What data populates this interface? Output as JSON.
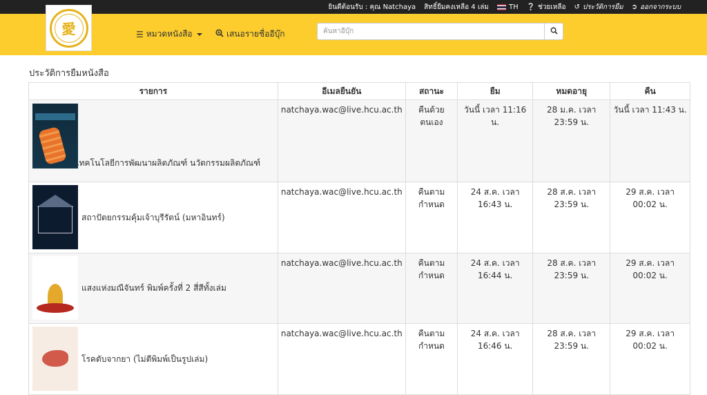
{
  "topbar": {
    "welcome": "ยินดีต้อนรับ : คุณ Natchaya",
    "quota": "สิทธิ์ยืมคงเหลือ 4 เล่ม",
    "lang": "TH",
    "help": "ช่วยเหลือ",
    "history": "ประวัติการยืม",
    "logout": "ออกจากระบบ"
  },
  "header": {
    "categories": "หมวดหนังสือ",
    "suggest": "เสนอรายชื่ออีบุ๊ก",
    "search_placeholder": "ค้นหาอีบุ๊ก"
  },
  "page_title": "ประวัติการยืมหนังสือ",
  "table": {
    "headers": [
      "รายการ",
      "อีเมลยืนยัน",
      "สถานะ",
      "ยืม",
      "หมดอายุ",
      "คืน"
    ],
    "rows": [
      {
        "title": "หลักการทางเทคโนโลยีการพัฒนาผลิตภัณฑ์ นวัตกรรมผลิตภัณฑ์",
        "email": "natchaya.wac@live.hcu.ac.th",
        "status": "คืนด้วยตนเอง",
        "borrow": "วันนี้ เวลา 11:16 น.",
        "expire": "28 ม.ค. เวลา 23:59 น.",
        "return": "วันนี้ เวลา 11:43 น."
      },
      {
        "title": "สถาปัตยกรรมคุ้มเจ้าบุรีรัตน์ (มหาอินทร์)",
        "email": "natchaya.wac@live.hcu.ac.th",
        "status": "คืนตามกำหนด",
        "borrow": "24 ส.ค. เวลา 16:43 น.",
        "expire": "28 ส.ค. เวลา 23:59 น.",
        "return": "29 ส.ค. เวลา 00:02 น."
      },
      {
        "title": "แสงแห่งมณีจันทร์ พิมพ์ครั้งที่ 2 สี่สีทั้งเล่ม",
        "email": "natchaya.wac@live.hcu.ac.th",
        "status": "คืนตามกำหนด",
        "borrow": "24 ส.ค. เวลา 16:44 น.",
        "expire": "28 ส.ค. เวลา 23:59 น.",
        "return": "29 ส.ค. เวลา 00:02 น."
      },
      {
        "title": "โรคตับจากยา (ไม่ตีพิมพ์เป็นรูปเล่ม)",
        "email": "natchaya.wac@live.hcu.ac.th",
        "status": "คืนตามกำหนด",
        "borrow": "24 ส.ค. เวลา 16:46 น.",
        "expire": "28 ส.ค. เวลา 23:59 น.",
        "return": "29 ส.ค. เวลา 00:02 น."
      }
    ]
  }
}
